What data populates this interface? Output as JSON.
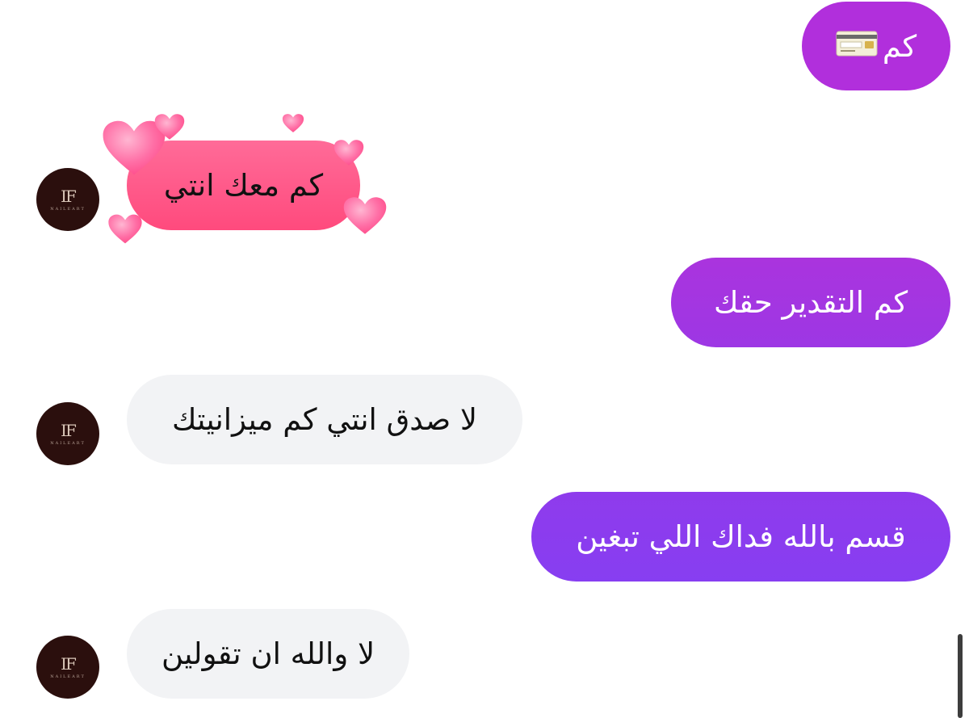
{
  "messages": [
    {
      "id": "m1",
      "direction": "outgoing",
      "text": "كم"
    },
    {
      "id": "m2",
      "direction": "incoming",
      "text": "كم معك انتي"
    },
    {
      "id": "m3",
      "direction": "outgoing",
      "text": "كم التقدير حقك"
    },
    {
      "id": "m4",
      "direction": "incoming",
      "text": "لا صدق انتي كم ميزانيتك"
    },
    {
      "id": "m5",
      "direction": "outgoing",
      "text": "قسم بالله فداك اللي تبغين"
    },
    {
      "id": "m6",
      "direction": "incoming",
      "text": "لا والله ان تقولين"
    }
  ],
  "contact": {
    "avatar_monogram": "IF",
    "avatar_wordmark": "NAILEART"
  },
  "icons": {
    "card": "credit-card-icon",
    "heart": "heart-icon"
  },
  "colors": {
    "outgoing_top": "#b435d8",
    "outgoing_bottom": "#8a3df0",
    "incoming_bg": "#f2f3f5",
    "love_bubble": "#ff4f86",
    "heart": "#ff6fa6"
  }
}
